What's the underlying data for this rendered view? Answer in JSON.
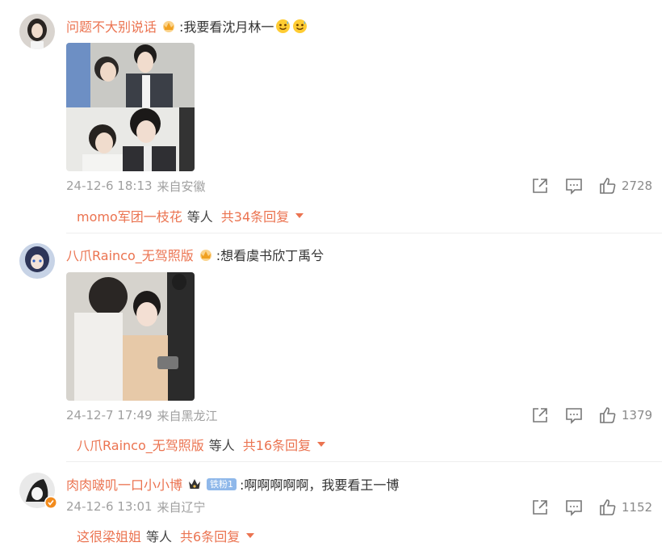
{
  "colors": {
    "accent": "#eb7350",
    "meta": "#a0a0a0"
  },
  "comments": [
    {
      "username": "问题不大别说话",
      "text": ":我要看沈月林一",
      "emoji": [
        "smile-sweat-emoji",
        "smile-sweat-emoji"
      ],
      "has_crown": true,
      "fan_badge": "",
      "time": "24-12-6 18:13",
      "location": "来自安徽",
      "likes": "2728",
      "reply": {
        "user": "momo军团一枝花",
        "mid": "等人",
        "count": "共34条回复"
      }
    },
    {
      "username": "八爪Rainco_无驾照版",
      "text": ":想看虞书欣丁禹兮",
      "emoji": [],
      "has_crown": true,
      "fan_badge": "",
      "time": "24-12-7 17:49",
      "location": "来自黑龙江",
      "likes": "1379",
      "reply": {
        "user": "八爪Rainco_无驾照版",
        "mid": "等人",
        "count": "共16条回复"
      }
    },
    {
      "username": "肉肉啵叽一口小小博",
      "text": ":啊啊啊啊啊，我要看王一博",
      "emoji": [],
      "has_crown": true,
      "fan_badge": "铁粉1",
      "time": "24-12-6 13:01",
      "location": "来自辽宁",
      "likes": "1152",
      "reply": {
        "user": "这很梁姐姐",
        "mid": "等人",
        "count": "共6条回复"
      }
    }
  ],
  "icons": {
    "share": "share-icon",
    "comment": "comment-icon",
    "like": "thumbs-up-icon"
  }
}
